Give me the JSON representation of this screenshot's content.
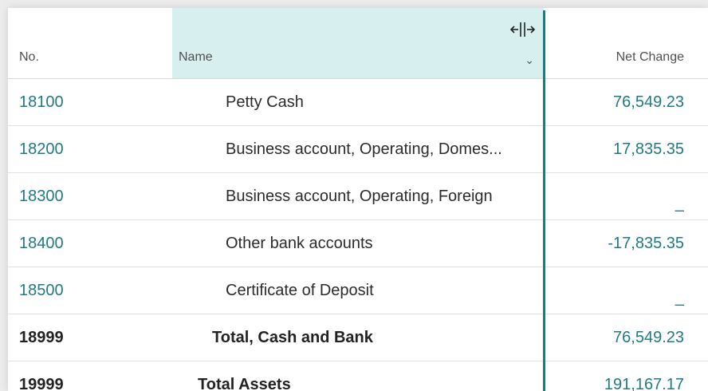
{
  "columns": {
    "no": "No.",
    "name": "Name",
    "net_change": "Net Change"
  },
  "rows": [
    {
      "no": "18100",
      "name": "Petty Cash",
      "net_change": "76,549.23"
    },
    {
      "no": "18200",
      "name": "Business account, Operating, Domes...",
      "net_change": "17,835.35"
    },
    {
      "no": "18300",
      "name": "Business account, Operating, Foreign",
      "net_change": "_"
    },
    {
      "no": "18400",
      "name": "Other bank accounts",
      "net_change": "-17,835.35"
    },
    {
      "no": "18500",
      "name": "Certificate of Deposit",
      "net_change": "_"
    },
    {
      "no": "18999",
      "name": "Total, Cash and Bank",
      "net_change": "76,549.23"
    },
    {
      "no": "19999",
      "name": "Total Assets",
      "net_change": "191,167.17"
    }
  ],
  "icons": {
    "column_resize": "column-resize-icon",
    "column_menu": "chevron-down-icon"
  },
  "colors": {
    "link": "#1f7a86",
    "header_highlight": "#d8eff0",
    "divider": "#1c7a86"
  }
}
